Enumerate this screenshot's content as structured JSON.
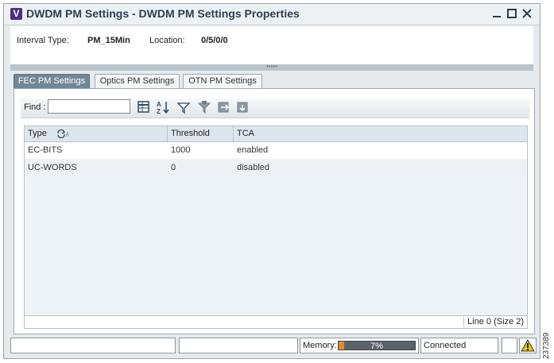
{
  "window": {
    "icon_letter": "V",
    "title": "DWDM PM Settings - DWDM PM Settings Properties"
  },
  "header": {
    "interval_label": "Interval Type:",
    "interval_value": "PM_15Min",
    "location_label": "Location:",
    "location_value": "0/5/0/0"
  },
  "tabs": [
    {
      "label": "FEC PM Settings",
      "active": true
    },
    {
      "label": "Optics PM Settings",
      "active": false
    },
    {
      "label": "OTN PM Settings",
      "active": false
    }
  ],
  "toolbar": {
    "find_label": "Find :",
    "find_value": "",
    "icons": [
      "table-settings-icon",
      "sort-az-icon",
      "filter-icon",
      "filter-funnel-icon",
      "export-icon",
      "print-icon"
    ]
  },
  "table": {
    "columns": [
      "Type",
      "Threshold",
      "TCA"
    ],
    "rows": [
      {
        "type": "EC-BITS",
        "threshold": "1000",
        "tca": "enabled"
      },
      {
        "type": "UC-WORDS",
        "threshold": "0",
        "tca": "disabled"
      }
    ],
    "footer": "Line 0 (Size 2)"
  },
  "statusbar": {
    "memory_label": "Memory:",
    "memory_text": "7%",
    "memory_fraction": 0.07,
    "connection": "Connected"
  },
  "side_code": "237389",
  "colors": {
    "active_tab": "#6f8796",
    "memory_fill": "#e28b2a",
    "warning": "#f2c200"
  }
}
